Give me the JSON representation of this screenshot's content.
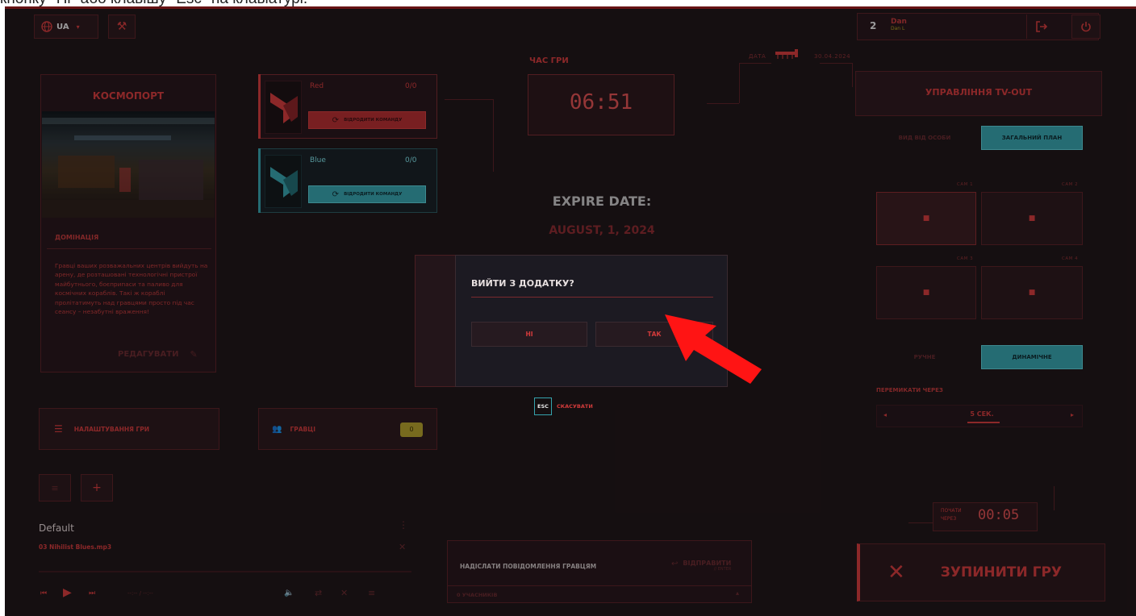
{
  "caption": "кнопку \"Ні\" або клавішу \"Esc\" на клавіатурі.",
  "topbar": {
    "language": "UA",
    "player_count": "2",
    "user_name": "Dan",
    "user_sub": "Dan L",
    "date_label": "ДАТА",
    "date_value": "30.04.2024"
  },
  "map_card": {
    "title": "КОСМОПОРТ",
    "mode": "ДОМІНАЦІЯ",
    "description": "Гравці ваших розважальних центрів вийдуть на арену, де розташовані технологічні пристрої майбутнього, боєприпаси та паливо для космічних кораблів. Такі ж кораблі пролітатимуть над гравцями просто під час сеансу – незабутні враження!",
    "edit_label": "РЕДАГУВАТИ"
  },
  "teams": [
    {
      "name": "Red",
      "score": "0/0",
      "button": "ВІДРОДИТИ КОМАНДУ"
    },
    {
      "name": "Blue",
      "score": "0/0",
      "button": "ВІДРОДИТИ КОМАНДУ"
    }
  ],
  "game_time": {
    "label": "ЧАС ГРИ",
    "value": "06:51"
  },
  "expire": {
    "label": "EXPIRE DATE:",
    "value": "AUGUST, 1, 2024"
  },
  "settings_btn": "НАЛАШТУВАННЯ ГРИ",
  "players_btn": {
    "label": "ГРАВЦІ",
    "count": "0"
  },
  "playlist": {
    "name": "Default",
    "track": "03 Nihilist Blues.mp3",
    "time": "--:-- / --:--"
  },
  "message": {
    "label": "НАДІСЛАТИ ПОВІДОМЛЕННЯ ГРАВЦЯМ",
    "send": "ВІДПРАВИТИ",
    "send_hint": "// ENTER",
    "participants": "0 УЧАСНИКІВ"
  },
  "dialog": {
    "title": "ВИЙТИ З ДОДАТКУ?",
    "no": "НІ",
    "yes": "ТАК",
    "esc_key": "ESC",
    "esc_label": "СКАСУВАТИ"
  },
  "tv_out": {
    "title": "УПРАВЛІННЯ TV-OUT",
    "view_first": "ВИД ВІД ОСОБИ",
    "view_general": "ЗАГАЛЬНИЙ ПЛАН",
    "cams": [
      "CAM 1",
      "CAM 2",
      "CAM 3",
      "CAM 4"
    ],
    "mode_manual": "РУЧНЕ",
    "mode_dynamic": "ДИНАМІЧНЕ",
    "switch_label": "ПЕРЕМИКАТИ ЧЕРЕЗ",
    "switch_value": "5 СЕК."
  },
  "start": {
    "label_1": "ПОЧАТИ",
    "label_2": "ЧЕРЕЗ",
    "value": "00:05"
  },
  "stop_btn": "ЗУПИНИТИ ГРУ",
  "colors": {
    "red": "#d33b3b",
    "teal": "#35a3ad",
    "bg": "#1d1416",
    "panel": "#251519"
  }
}
